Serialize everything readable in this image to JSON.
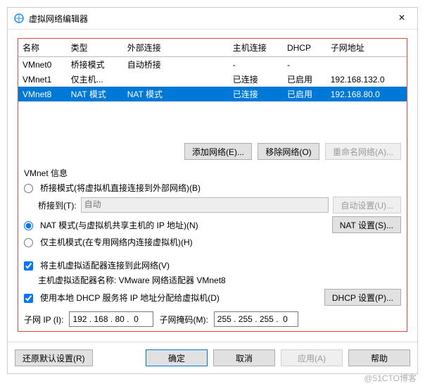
{
  "title": "虚拟网络编辑器",
  "columns": [
    "名称",
    "类型",
    "外部连接",
    "主机连接",
    "DHCP",
    "子网地址"
  ],
  "rows": [
    {
      "name": "VMnet0",
      "type": "桥接模式",
      "ext": "自动桥接",
      "host": "-",
      "dhcp": "-",
      "subnet": ""
    },
    {
      "name": "VMnet1",
      "type": "仅主机...",
      "ext": "",
      "host": "已连接",
      "dhcp": "已启用",
      "subnet": "192.168.132.0"
    },
    {
      "name": "VMnet8",
      "type": "NAT 模式",
      "ext": "NAT 模式",
      "host": "已连接",
      "dhcp": "已启用",
      "subnet": "192.168.80.0"
    }
  ],
  "buttons": {
    "add": "添加网络(E)...",
    "remove": "移除网络(O)",
    "rename": "重命名网络(A)...",
    "auto": "自动设置(U)...",
    "nat": "NAT 设置(S)...",
    "dhcp": "DHCP 设置(P)...",
    "restore": "还原默认设置(R)",
    "ok": "确定",
    "cancel": "取消",
    "apply": "应用(A)",
    "help": "帮助"
  },
  "info": {
    "group": "VMnet 信息",
    "bridge": "桥接模式(将虚拟机直接连接到外部网络)(B)",
    "bridge_to": "桥接到(T):",
    "bridge_sel": "自动",
    "nat": "NAT 模式(与虚拟机共享主机的 IP 地址)(N)",
    "hostonly": "仅主机模式(在专用网络内连接虚拟机)(H)",
    "connect": "将主机虚拟适配器连接到此网络(V)",
    "adapter": "主机虚拟适配器名称: VMware 网络适配器 VMnet8",
    "usedhcp": "使用本地 DHCP 服务将 IP 地址分配给虚拟机(D)",
    "subnet_ip_l": "子网 IP (I):",
    "subnet_ip_v": "192 . 168 . 80 .  0",
    "subnet_mask_l": "子网掩码(M):",
    "subnet_mask_v": "255 . 255 . 255 .  0"
  },
  "watermark": "@51CTO博客"
}
